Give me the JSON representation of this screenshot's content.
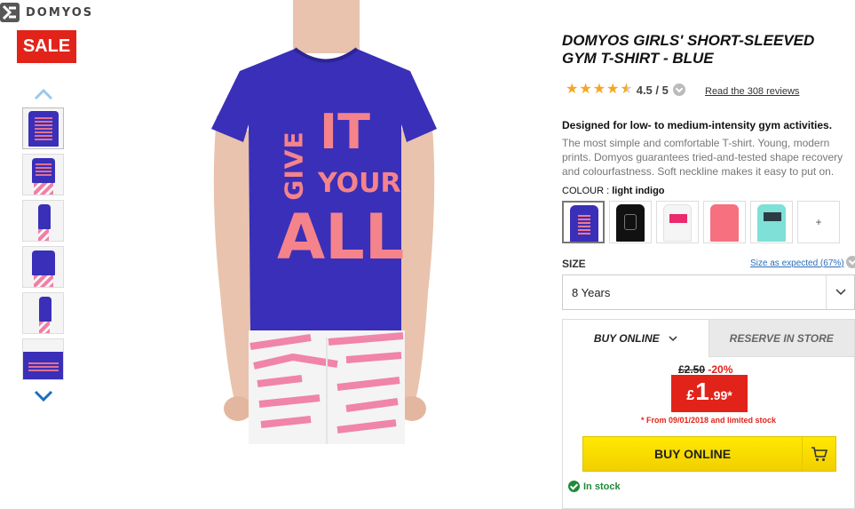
{
  "brand": {
    "name": "DOMYOS"
  },
  "badge": {
    "sale": "SALE"
  },
  "product": {
    "title": "DOMYOS GIRLS' SHORT-SLEEVED GYM T-SHIRT - BLUE",
    "rating_value": "4.5",
    "rating_max": "5",
    "rating_text": "4.5 / 5",
    "stars": 4.5,
    "reviews_link": "Read the 308 reviews",
    "description_heading": "Designed for low- to medium-intensity gym activities.",
    "description": "The most simple and comfortable T-shirt. Young, modern prints. Domyos guarantees tried-and-tested shape recovery and colourfastness. Soft neckline makes it easy to put on.",
    "shirt_print": [
      "GIVE",
      "IT",
      "YOUR",
      "ALL"
    ]
  },
  "colour": {
    "label": "COLOUR :",
    "value": "light indigo",
    "swatches": [
      {
        "name": "light indigo",
        "color": "#3a2fb8",
        "selected": true
      },
      {
        "name": "black",
        "color": "#111111",
        "selected": false
      },
      {
        "name": "white",
        "color": "#f5f5f5",
        "selected": false
      },
      {
        "name": "pink",
        "color": "#f6707f",
        "selected": false
      },
      {
        "name": "mint",
        "color": "#7ee0d6",
        "selected": false
      }
    ],
    "more_label": "+"
  },
  "size": {
    "label": "SIZE",
    "fit_link": "Size as expected (67%)",
    "selected": "8 Years"
  },
  "buy": {
    "tab_online": "BUY ONLINE",
    "tab_reserve": "RESERVE IN STORE",
    "old_price": "£2.50",
    "discount": "-20%",
    "price_currency": "£",
    "price_int": "1",
    "price_dec": ".99*",
    "price_note": "* From 09/01/2018 and limited stock",
    "button_label": "BUY ONLINE",
    "stock": "In stock"
  },
  "colors": {
    "accent_red": "#e2231a",
    "buy_yellow": "#ffe900",
    "stock_green": "#1f8a3a",
    "link_blue": "#2a6db5"
  }
}
